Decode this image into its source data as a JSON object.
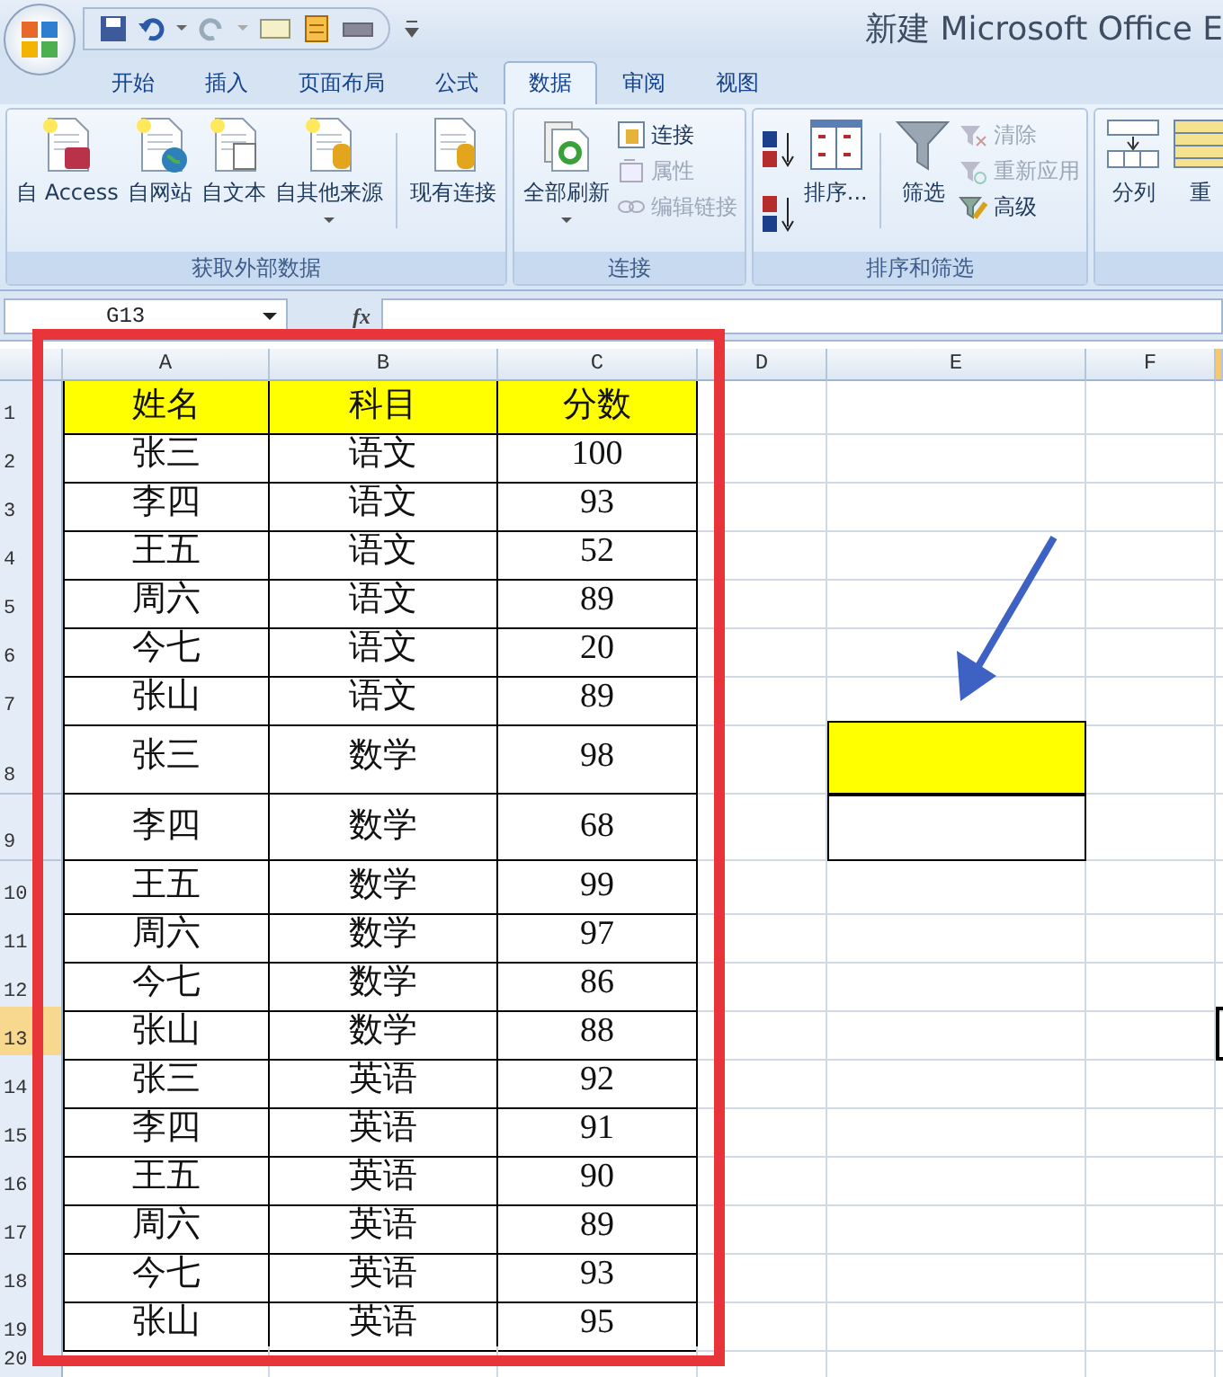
{
  "window": {
    "title": "新建 Microsoft Office E"
  },
  "tabs": [
    {
      "label": "开始",
      "selected": false
    },
    {
      "label": "插入",
      "selected": false
    },
    {
      "label": "页面布局",
      "selected": false
    },
    {
      "label": "公式",
      "selected": false
    },
    {
      "label": "数据",
      "selected": true
    },
    {
      "label": "审阅",
      "selected": false
    },
    {
      "label": "视图",
      "selected": false
    }
  ],
  "ribbon_groups": [
    {
      "title": "获取外部数据",
      "items": [
        {
          "kind": "large",
          "label": "自 Access"
        },
        {
          "kind": "large",
          "label": "自网站"
        },
        {
          "kind": "large",
          "label": "自文本"
        },
        {
          "kind": "large",
          "label": "自其他来源",
          "caret": true
        },
        {
          "kind": "separator"
        },
        {
          "kind": "large",
          "label": "现有连接"
        }
      ]
    },
    {
      "title": "连接",
      "items": [
        {
          "kind": "large",
          "label": "全部刷新",
          "caret": true
        },
        {
          "kind": "small_stack",
          "entries": [
            {
              "label": "连接",
              "disabled": false
            },
            {
              "label": "属性",
              "disabled": true
            },
            {
              "label": "编辑链接",
              "disabled": true
            }
          ]
        }
      ]
    },
    {
      "title": "排序和筛选",
      "items": [
        {
          "kind": "sort_pair"
        },
        {
          "kind": "large",
          "label": "排序..."
        },
        {
          "kind": "separator"
        },
        {
          "kind": "large",
          "label": "筛选"
        },
        {
          "kind": "small_stack",
          "entries": [
            {
              "label": "清除",
              "disabled": true
            },
            {
              "label": "重新应用",
              "disabled": true
            },
            {
              "label": "高级",
              "disabled": false
            }
          ]
        }
      ]
    },
    {
      "items": [
        {
          "kind": "large",
          "label": "分列"
        },
        {
          "kind": "large",
          "label": "重"
        }
      ]
    }
  ],
  "name_box": "G13",
  "fx": "fx",
  "columns": [
    "A",
    "B",
    "C",
    "D",
    "E",
    "F"
  ],
  "rows": [
    {
      "number": "1",
      "selected": false,
      "header": true,
      "cells": [
        "姓名",
        "科目",
        "分数"
      ]
    },
    {
      "number": "2",
      "selected": false,
      "cells": [
        "张三",
        "语文",
        "100"
      ]
    },
    {
      "number": "3",
      "selected": false,
      "cells": [
        "李四",
        "语文",
        "93"
      ]
    },
    {
      "number": "4",
      "selected": false,
      "cells": [
        "王五",
        "语文",
        "52"
      ]
    },
    {
      "number": "5",
      "selected": false,
      "cells": [
        "周六",
        "语文",
        "89"
      ]
    },
    {
      "number": "6",
      "selected": false,
      "cells": [
        "今七",
        "语文",
        "20"
      ]
    },
    {
      "number": "7",
      "selected": false,
      "cells": [
        "张山",
        "语文",
        "89"
      ]
    },
    {
      "number": "8",
      "selected": false,
      "cells": [
        "张三",
        "数学",
        "98"
      ],
      "side_cell": {
        "filled": true
      }
    },
    {
      "number": "9",
      "selected": false,
      "cells": [
        "李四",
        "数学",
        "68"
      ],
      "side_cell": {
        "filled": false
      }
    },
    {
      "number": "10",
      "selected": false,
      "cells": [
        "王五",
        "数学",
        "99"
      ]
    },
    {
      "number": "11",
      "selected": false,
      "cells": [
        "周六",
        "数学",
        "97"
      ]
    },
    {
      "number": "12",
      "selected": false,
      "cells": [
        "今七",
        "数学",
        "86"
      ]
    },
    {
      "number": "13",
      "selected": true,
      "cells": [
        "张山",
        "数学",
        "88"
      ]
    },
    {
      "number": "14",
      "selected": false,
      "cells": [
        "张三",
        "英语",
        "92"
      ]
    },
    {
      "number": "15",
      "selected": false,
      "cells": [
        "李四",
        "英语",
        "91"
      ]
    },
    {
      "number": "16",
      "selected": false,
      "cells": [
        "王五",
        "英语",
        "90"
      ]
    },
    {
      "number": "17",
      "selected": false,
      "cells": [
        "周六",
        "英语",
        "89"
      ]
    },
    {
      "number": "18",
      "selected": false,
      "cells": [
        "今七",
        "英语",
        "93"
      ]
    },
    {
      "number": "19",
      "selected": false,
      "cells": [
        "张山",
        "英语",
        "95"
      ]
    },
    {
      "number": "20",
      "selected": false
    }
  ]
}
